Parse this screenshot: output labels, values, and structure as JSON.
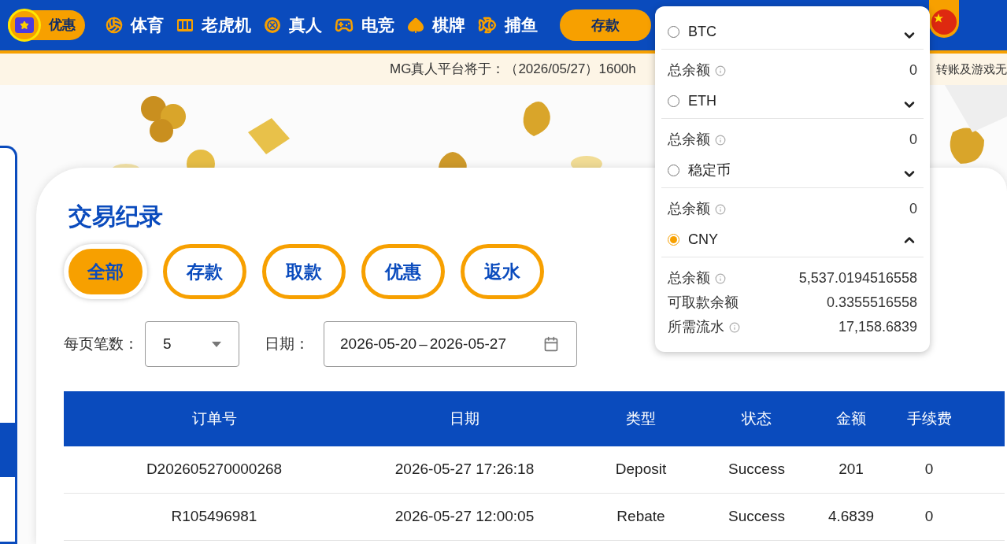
{
  "header": {
    "promo": {
      "label": "优惠"
    },
    "nav": [
      {
        "label": "体育",
        "kind": "ball"
      },
      {
        "label": "老虎机",
        "kind": "slot"
      },
      {
        "label": "真人",
        "kind": "chip"
      },
      {
        "label": "电竞",
        "kind": "gamepad"
      },
      {
        "label": "棋牌",
        "kind": "cards"
      },
      {
        "label": "捕鱼",
        "kind": "fish"
      }
    ],
    "deposit_button": "存款"
  },
  "notice": [
    "MG真人平台将于：（2026/05/27）1600h",
    "转账及游戏无"
  ],
  "page": {
    "title": "交易纪录",
    "tabs": [
      {
        "label": "全部",
        "selected": true
      },
      {
        "label": "存款",
        "selected": false
      },
      {
        "label": "取款",
        "selected": false
      },
      {
        "label": "优惠",
        "selected": false
      },
      {
        "label": "返水",
        "selected": false
      }
    ],
    "per_page": {
      "label": "每页笔数：",
      "value": "5"
    },
    "date": {
      "label": "日期：",
      "start": "2026-05-20",
      "separator": "–",
      "end": "2026-05-27"
    },
    "table": {
      "columns": [
        "订单号",
        "日期",
        "类型",
        "状态",
        "金额",
        "手续费"
      ],
      "rows": [
        [
          "D202605270000268",
          "2026-05-27 17:26:18",
          "Deposit",
          "Success",
          "201",
          "0"
        ],
        [
          "R105496981",
          "2026-05-27 12:00:05",
          "Rebate",
          "Success",
          "4.6839",
          "0"
        ]
      ]
    }
  },
  "wallet_menu": {
    "currencies": [
      {
        "name": "BTC",
        "selected": false,
        "expanded": false,
        "balances": [
          {
            "label": "总余额",
            "info": true,
            "value": "0"
          }
        ]
      },
      {
        "name": "ETH",
        "selected": false,
        "expanded": false,
        "balances": [
          {
            "label": "总余额",
            "info": true,
            "value": "0"
          }
        ]
      },
      {
        "name": "稳定币",
        "selected": false,
        "expanded": false,
        "balances": [
          {
            "label": "总余额",
            "info": true,
            "value": "0"
          }
        ]
      },
      {
        "name": "CNY",
        "selected": true,
        "expanded": true,
        "balances": [
          {
            "label": "总余额",
            "info": true,
            "value": "5,537.0194516558"
          },
          {
            "label": "可取款余额",
            "info": false,
            "value": "0.3355516558"
          },
          {
            "label": "所需流水",
            "info": true,
            "value": "17,158.6839"
          }
        ]
      }
    ]
  }
}
